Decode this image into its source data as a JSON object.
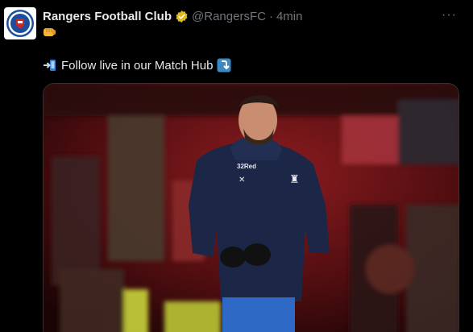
{
  "tweet": {
    "display_name": "Rangers Football Club",
    "handle": "@RangersFC",
    "separator": "·",
    "time": "4min",
    "more": "···",
    "text": "Follow live in our Match Hub",
    "icons": {
      "avatar": "rangers-crest-icon",
      "verified": "verified-badge-icon",
      "fist": "oncoming-fist-emoji-icon",
      "arrow_in": "arrow-into-phone-emoji-icon",
      "arrow_down": "arrow-curving-down-emoji-icon"
    },
    "colors": {
      "verified_gold": "#e2b719",
      "crest_blue": "#1b4f9c",
      "crest_red": "#d2232a"
    }
  },
  "media": {
    "jersey_brand": "32Red"
  }
}
